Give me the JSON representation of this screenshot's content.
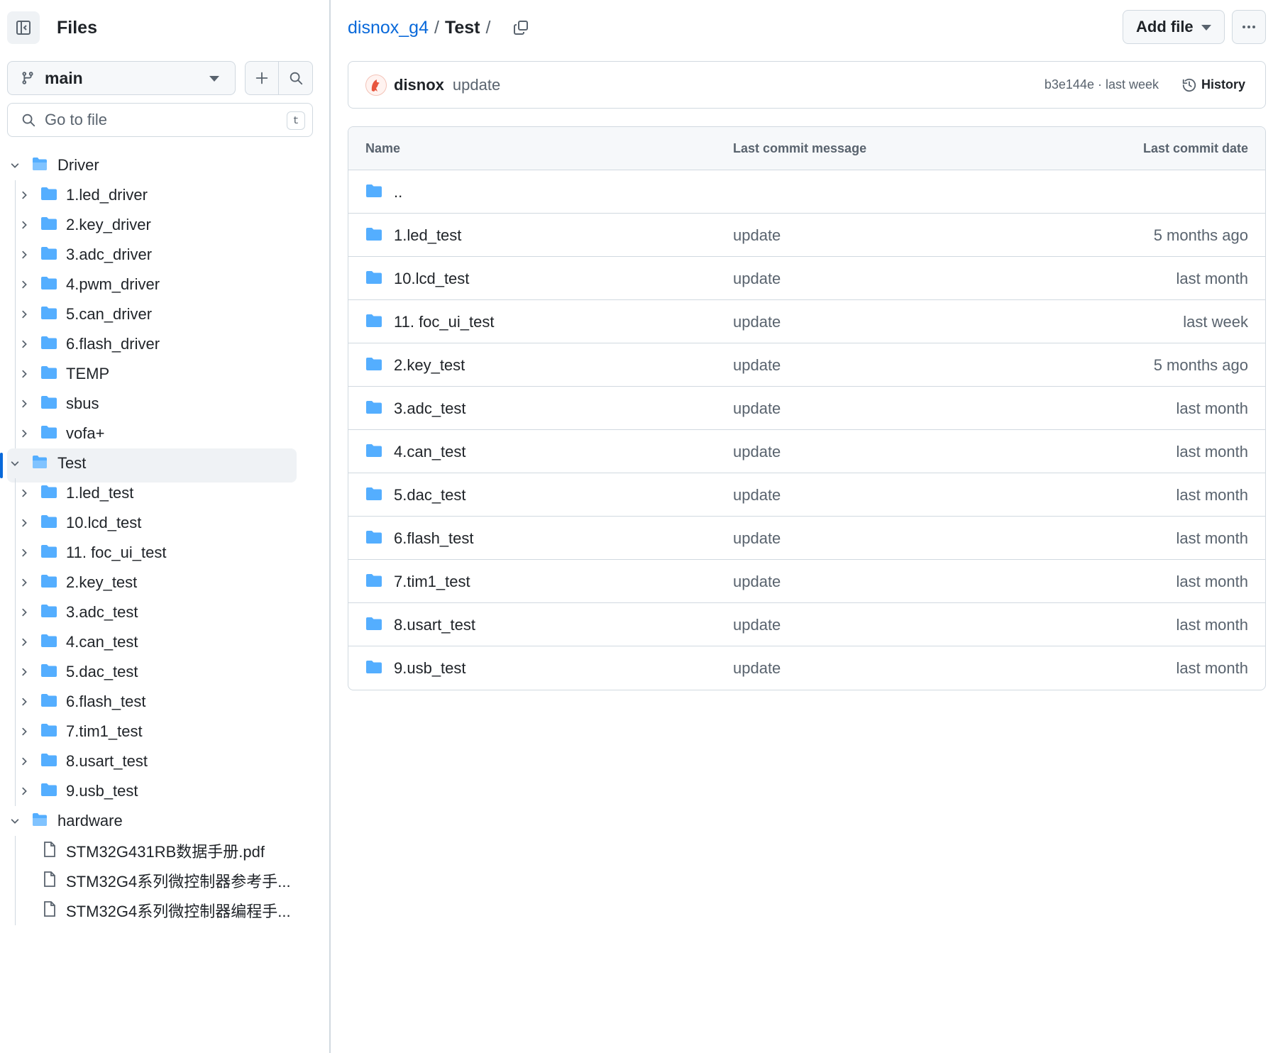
{
  "sidebar": {
    "title": "Files",
    "branch": "main",
    "goto": {
      "placeholder": "Go to file",
      "shortcut": "t"
    },
    "tree": [
      {
        "label": "Driver",
        "level": 0,
        "type": "folder",
        "expanded": true
      },
      {
        "label": "1.led_driver",
        "level": 1,
        "type": "folder"
      },
      {
        "label": "2.key_driver",
        "level": 1,
        "type": "folder"
      },
      {
        "label": "3.adc_driver",
        "level": 1,
        "type": "folder"
      },
      {
        "label": "4.pwm_driver",
        "level": 1,
        "type": "folder"
      },
      {
        "label": "5.can_driver",
        "level": 1,
        "type": "folder"
      },
      {
        "label": "6.flash_driver",
        "level": 1,
        "type": "folder"
      },
      {
        "label": "TEMP",
        "level": 1,
        "type": "folder"
      },
      {
        "label": "sbus",
        "level": 1,
        "type": "folder"
      },
      {
        "label": "vofa+",
        "level": 1,
        "type": "folder"
      },
      {
        "label": "Test",
        "level": 0,
        "type": "folder",
        "expanded": true,
        "selected": true
      },
      {
        "label": "1.led_test",
        "level": 1,
        "type": "folder"
      },
      {
        "label": "10.lcd_test",
        "level": 1,
        "type": "folder"
      },
      {
        "label": "11. foc_ui_test",
        "level": 1,
        "type": "folder"
      },
      {
        "label": "2.key_test",
        "level": 1,
        "type": "folder"
      },
      {
        "label": "3.adc_test",
        "level": 1,
        "type": "folder"
      },
      {
        "label": "4.can_test",
        "level": 1,
        "type": "folder"
      },
      {
        "label": "5.dac_test",
        "level": 1,
        "type": "folder"
      },
      {
        "label": "6.flash_test",
        "level": 1,
        "type": "folder"
      },
      {
        "label": "7.tim1_test",
        "level": 1,
        "type": "folder"
      },
      {
        "label": "8.usart_test",
        "level": 1,
        "type": "folder"
      },
      {
        "label": "9.usb_test",
        "level": 1,
        "type": "folder"
      },
      {
        "label": "hardware",
        "level": 0,
        "type": "folder",
        "expanded": true
      },
      {
        "label": "STM32G431RB数据手册.pdf",
        "level": 1,
        "type": "file"
      },
      {
        "label": "STM32G4系列微控制器参考手...",
        "level": 1,
        "type": "file"
      },
      {
        "label": "STM32G4系列微控制器编程手...",
        "level": 1,
        "type": "file"
      }
    ]
  },
  "breadcrumb": {
    "repo": "disnox_g4",
    "separator": "/",
    "current": "Test"
  },
  "actions": {
    "add_file": "Add file"
  },
  "commit": {
    "author": "disnox",
    "message": "update",
    "meta": "b3e144e · last week",
    "history": "History"
  },
  "table": {
    "headers": {
      "name": "Name",
      "message": "Last commit message",
      "date": "Last commit date"
    },
    "parent": "..",
    "rows": [
      {
        "name": "1.led_test",
        "message": "update",
        "date": "5 months ago"
      },
      {
        "name": "10.lcd_test",
        "message": "update",
        "date": "last month"
      },
      {
        "name": "11. foc_ui_test",
        "message": "update",
        "date": "last week"
      },
      {
        "name": "2.key_test",
        "message": "update",
        "date": "5 months ago"
      },
      {
        "name": "3.adc_test",
        "message": "update",
        "date": "last month"
      },
      {
        "name": "4.can_test",
        "message": "update",
        "date": "last month"
      },
      {
        "name": "5.dac_test",
        "message": "update",
        "date": "last month"
      },
      {
        "name": "6.flash_test",
        "message": "update",
        "date": "last month"
      },
      {
        "name": "7.tim1_test",
        "message": "update",
        "date": "last month"
      },
      {
        "name": "8.usart_test",
        "message": "update",
        "date": "last month"
      },
      {
        "name": "9.usb_test",
        "message": "update",
        "date": "last month"
      }
    ]
  },
  "colors": {
    "accent": "#0969da",
    "folder": "#54aeff",
    "border": "#d1d9e0",
    "muted": "#59636e"
  },
  "icons": {
    "panel": "sidebar-collapse-icon",
    "branch": "git-branch-icon",
    "add": "plus-icon",
    "search": "search-icon",
    "folder": "folder-icon",
    "file": "file-icon",
    "chevron": "chevron-icon",
    "copy": "copy-icon",
    "history": "history-icon",
    "more": "kebab-horizontal-icon"
  }
}
